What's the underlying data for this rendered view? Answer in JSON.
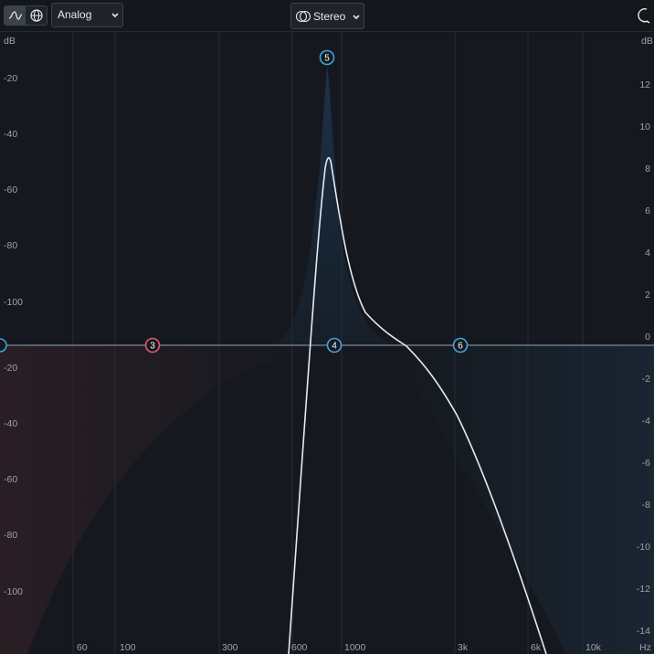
{
  "toolbar": {
    "view_mode_icons": [
      "eq-curve-icon",
      "globe-icon"
    ],
    "mode_select": {
      "value": "Analog"
    },
    "channel_select": {
      "value": "Stereo",
      "icon": "stereo-rings-icon"
    },
    "reset_icon": "rotate-icon"
  },
  "graph": {
    "left_axis_unit": "dB",
    "right_axis_unit": "dB",
    "frequency_unit": "Hz",
    "left_axis_upper": [
      "-20",
      "-40",
      "-60",
      "-80",
      "-100"
    ],
    "left_axis_lower": [
      "-20",
      "-40",
      "-60",
      "-80",
      "-100"
    ],
    "right_axis": [
      "12",
      "10",
      "8",
      "6",
      "4",
      "2",
      "0",
      "-2",
      "-4",
      "-6",
      "-8",
      "-10",
      "-12",
      "-14"
    ],
    "freq_ticks": [
      "60",
      "100",
      "300",
      "600",
      "1000",
      "3k",
      "6k",
      "10k"
    ]
  },
  "nodes": [
    {
      "label": "3",
      "color": "#e05a72"
    },
    {
      "label": "4",
      "color": "#3fa6d8"
    },
    {
      "label": "5",
      "color": "#3fa6d8"
    },
    {
      "label": "6",
      "color": "#3fa6d8"
    }
  ],
  "colors": {
    "background": "#15191f",
    "grid": "#2a3038",
    "curve": "#e8eaee",
    "accent_blue": "#3fa6d8",
    "accent_red": "#e05a72"
  }
}
